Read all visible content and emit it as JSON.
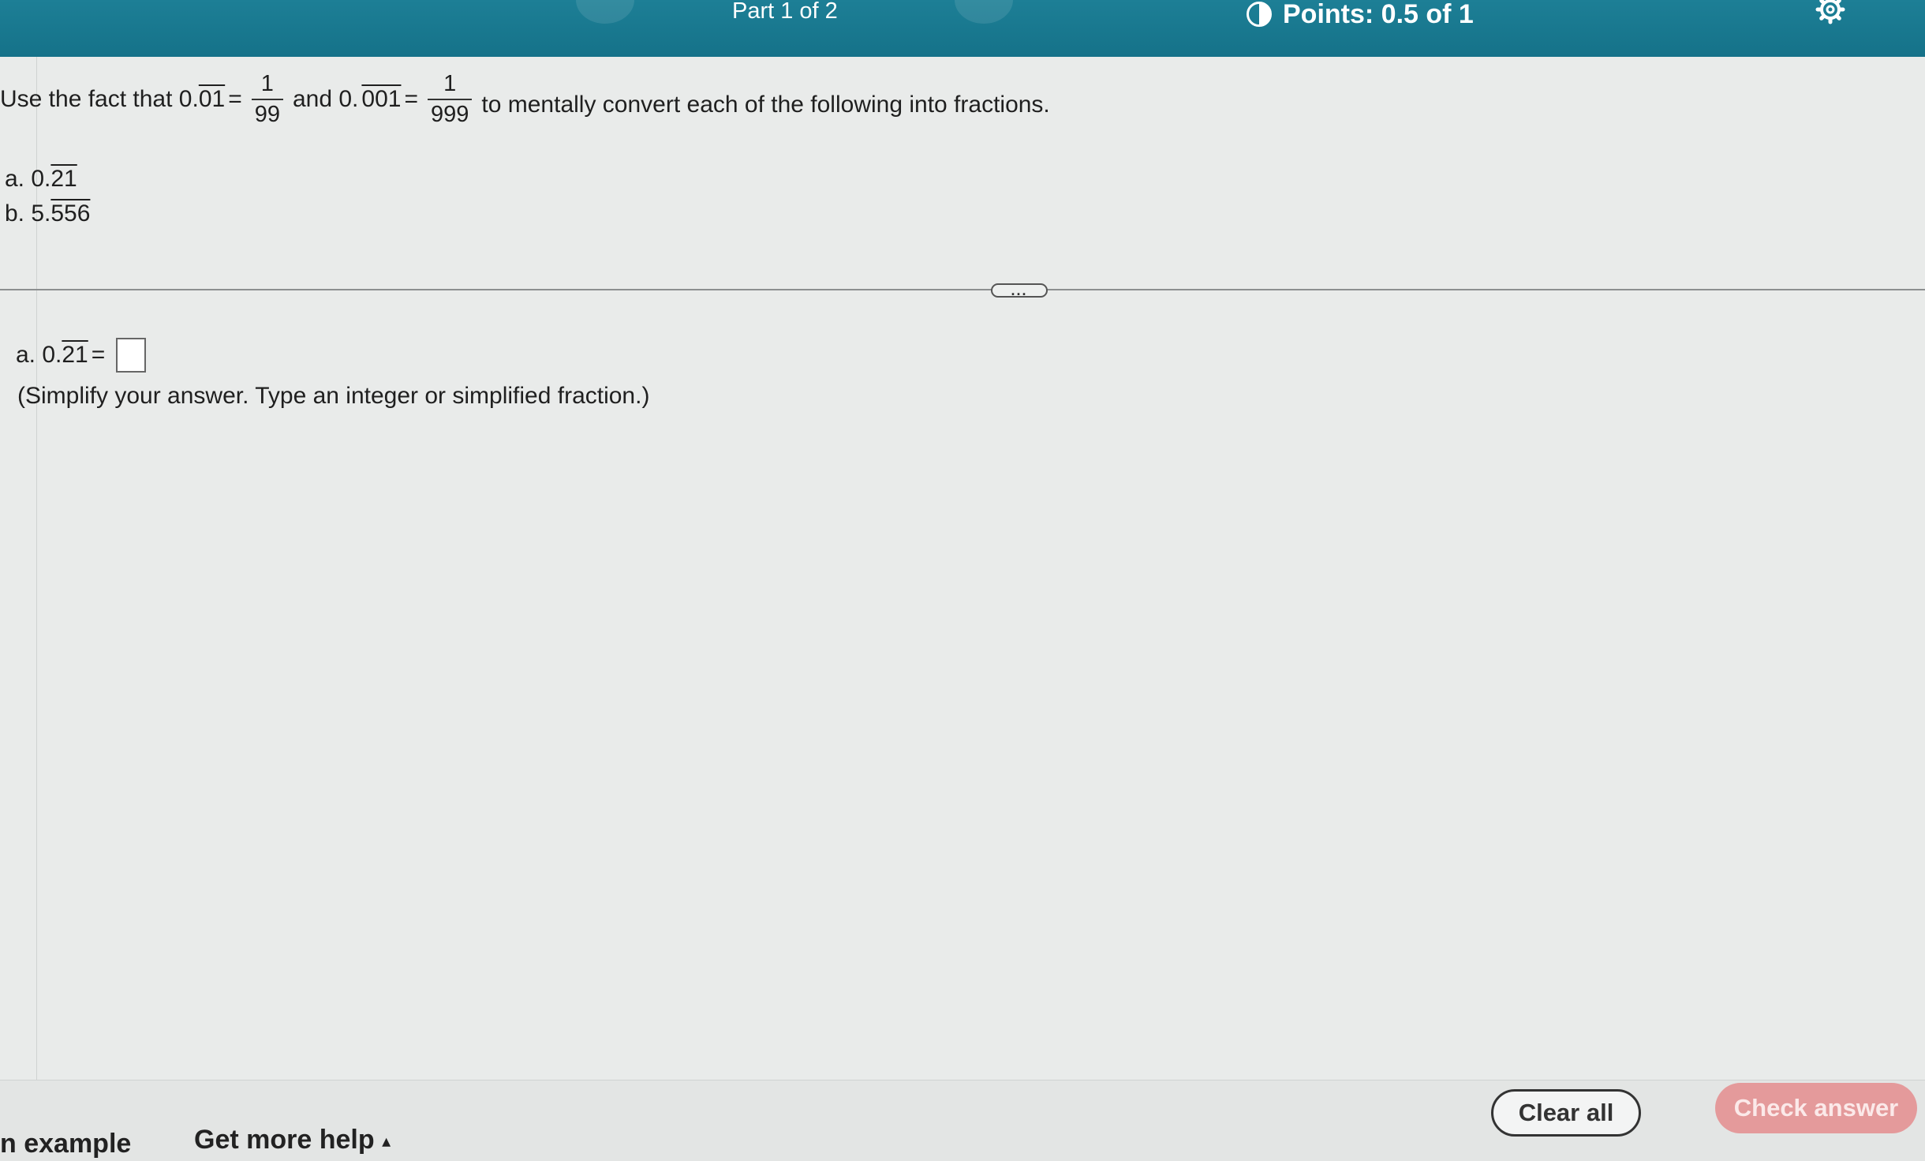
{
  "header": {
    "part_label": "Part 1 of 2",
    "points_label": "Points: 0.5 of 1",
    "points_fraction": 0.5,
    "settings_icon": "gear-icon",
    "score_icon": "half-circle-icon"
  },
  "question": {
    "intro_prefix": "Use the fact that 0.",
    "rep1_digits": "01",
    "eq1": "=",
    "frac1_num": "1",
    "frac1_den": "99",
    "and_text": "and 0.",
    "rep2_digits": "001",
    "eq2": "=",
    "frac2_num": "1",
    "frac2_den": "999",
    "intro_suffix": "to mentally convert each of the following into fractions.",
    "items": [
      {
        "label": "a. 0.",
        "repeating": "21"
      },
      {
        "label": "b. 5.",
        "repeating": "556"
      }
    ]
  },
  "more_button": "...",
  "answer": {
    "label": "a. 0.",
    "repeating": "21",
    "equals": "=",
    "value": "",
    "instruction": "(Simplify your answer. Type an integer or simplified fraction.)"
  },
  "footer": {
    "example_link": "n example",
    "help_link": "Get more help",
    "help_caret": "▴",
    "clear_button": "Clear all",
    "check_button": "Check answer"
  },
  "colors": {
    "header_bg": "#157289",
    "check_button_bg": "#e49a9b",
    "page_bg": "#e9ebea"
  }
}
